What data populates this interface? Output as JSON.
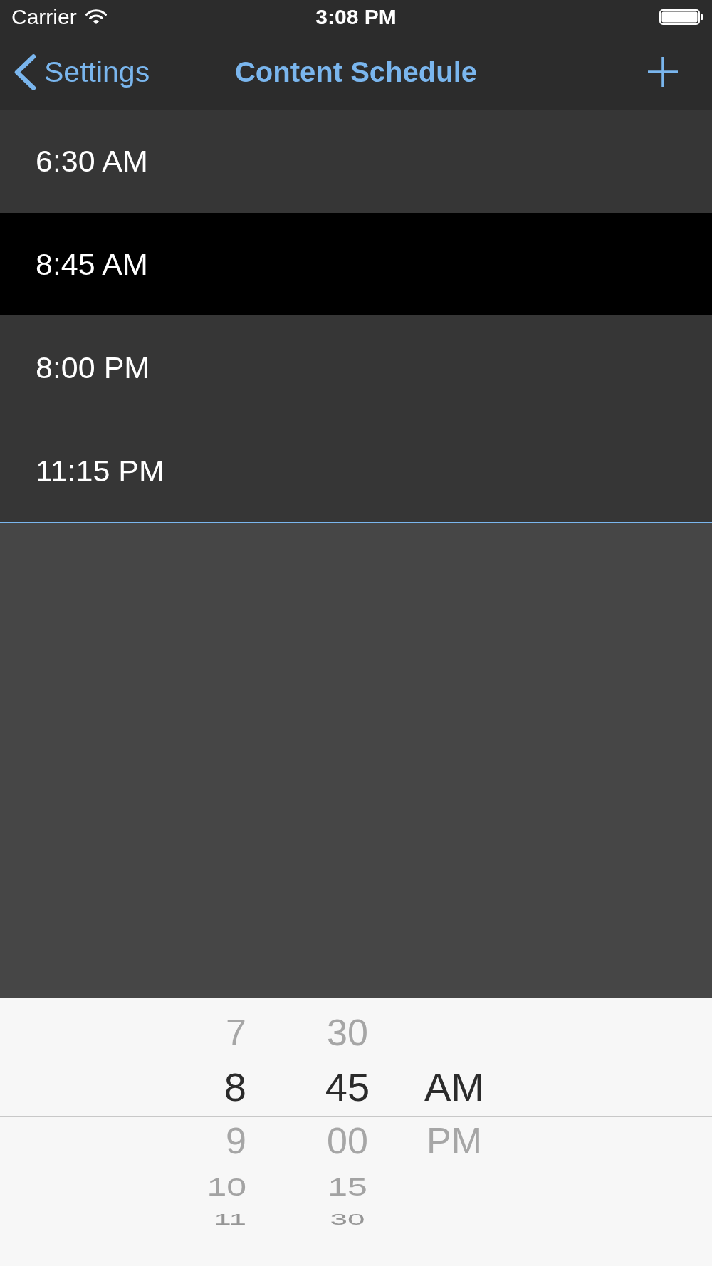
{
  "status_bar": {
    "carrier": "Carrier",
    "time": "3:08 PM"
  },
  "nav_bar": {
    "back": "Settings",
    "title": "Content Schedule"
  },
  "schedule": [
    {
      "time": "6:30 AM",
      "selected": false
    },
    {
      "time": "8:45 AM",
      "selected": true
    },
    {
      "time": "8:00 PM",
      "selected": false
    },
    {
      "time": "11:15 PM",
      "selected": false
    }
  ],
  "picker": {
    "columns": [
      {
        "kind": "hour",
        "items": [
          {
            "label": "7",
            "selected": false
          },
          {
            "label": "8",
            "selected": true
          },
          {
            "label": "9",
            "selected": false
          },
          {
            "label": "10",
            "selected": false
          },
          {
            "label": "11",
            "selected": false
          }
        ]
      },
      {
        "kind": "minute",
        "items": [
          {
            "label": "30",
            "selected": false
          },
          {
            "label": "45",
            "selected": true
          },
          {
            "label": "00",
            "selected": false
          },
          {
            "label": "15",
            "selected": false
          },
          {
            "label": "30",
            "selected": false
          }
        ]
      },
      {
        "kind": "period",
        "items": [
          {
            "label": "AM",
            "selected": true
          },
          {
            "label": "PM",
            "selected": false
          }
        ]
      }
    ]
  }
}
